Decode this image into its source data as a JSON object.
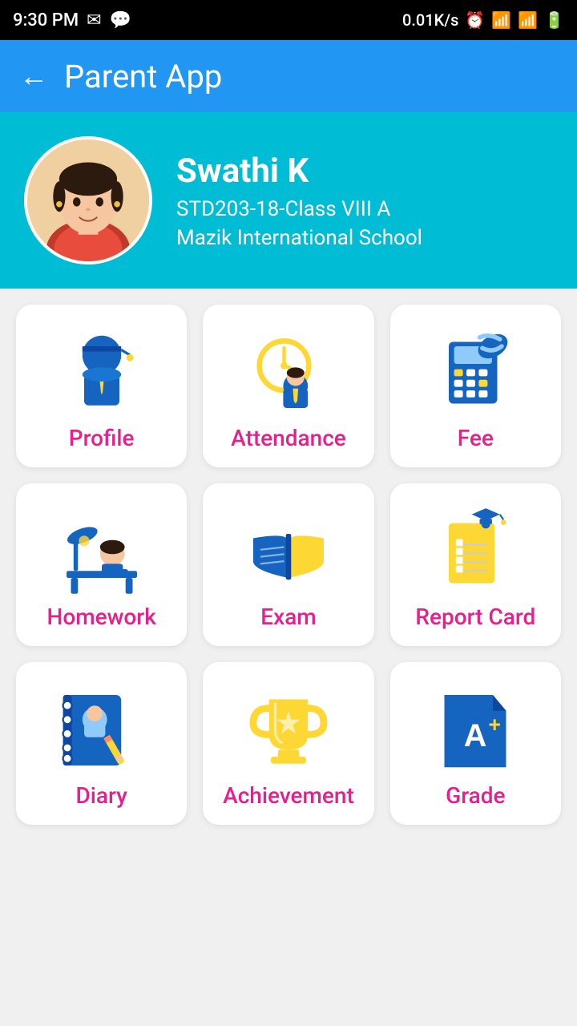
{
  "statusBar": {
    "time": "9:30 PM",
    "network": "0.01K/s",
    "battery": "100"
  },
  "topBar": {
    "title": "Parent App",
    "backLabel": "←"
  },
  "profile": {
    "name": "Swathi K",
    "studentId": "STD203-18-Class VIII A",
    "school": "Mazik International School"
  },
  "grid": {
    "items": [
      {
        "id": "profile",
        "label": "Profile"
      },
      {
        "id": "attendance",
        "label": "Attendance"
      },
      {
        "id": "fee",
        "label": "Fee"
      },
      {
        "id": "homework",
        "label": "Homework"
      },
      {
        "id": "exam",
        "label": "Exam"
      },
      {
        "id": "report-card",
        "label": "Report Card"
      },
      {
        "id": "diary",
        "label": "Diary"
      },
      {
        "id": "achievement",
        "label": "Achievement"
      },
      {
        "id": "grade",
        "label": "Grade"
      }
    ]
  }
}
